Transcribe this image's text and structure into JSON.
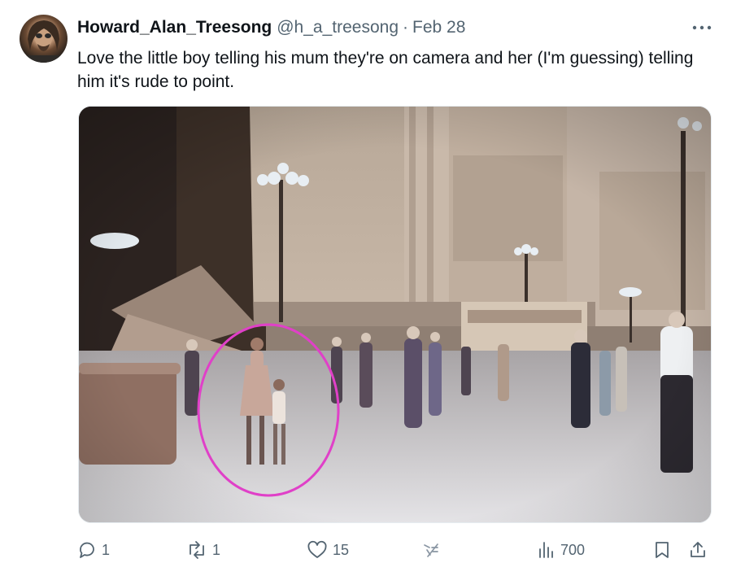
{
  "tweet": {
    "author_name": "Howard_Alan_Treesong",
    "handle": "@h_a_treesong",
    "separator": "·",
    "date": "Feb 28",
    "text": "Love the little boy telling his mum they're on camera and her (I'm guessing) telling him it's rude to point."
  },
  "actions": {
    "reply_count": "1",
    "retweet_count": "1",
    "like_count": "15",
    "view_count": "700"
  },
  "icons": {
    "more": "more-horizontal-icon",
    "reply": "reply-icon",
    "retweet": "retweet-icon",
    "like": "heart-icon",
    "grok": "grok-icon",
    "views": "views-bar-chart-icon",
    "bookmark": "bookmark-icon",
    "share": "share-icon"
  },
  "colors": {
    "text": "#0f1419",
    "secondary": "#536471",
    "highlight_circle": "#e040c8"
  }
}
